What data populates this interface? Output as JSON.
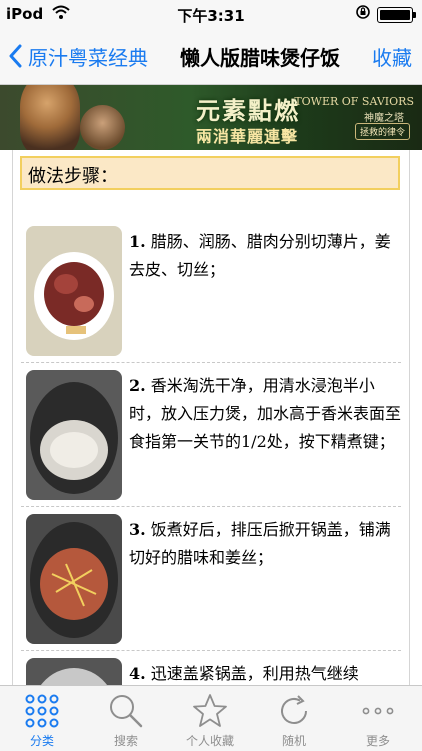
{
  "status": {
    "carrier": "iPod",
    "time": "下午3:31"
  },
  "nav": {
    "back_label": "原汁粤菜经典",
    "title": "懒人版腊味煲仔饭",
    "favorite_label": "收藏"
  },
  "banner": {
    "slogan_main": "元素點燃",
    "slogan_sub": "兩消華麗連擊",
    "brand_en": "TOWER OF SAVIORS",
    "brand_cn": "神魔之塔",
    "brand_tag": "拯救的律令"
  },
  "section_title": "做法步骤：",
  "steps": [
    {
      "num": "1.",
      "text": "腊肠、润肠、腊肉分别切薄片，姜去皮、切丝；"
    },
    {
      "num": "2.",
      "text": "香米淘洗干净，用清水浸泡半小时，放入压力煲，加水高于香米表面至食指第一关节的1/2处，按下精煮键；"
    },
    {
      "num": "3.",
      "text": "饭煮好后，排压后掀开锅盖，铺满切好的腊味和姜丝；"
    },
    {
      "num": "4.",
      "text": "迅速盖紧锅盖，利用热气继续"
    }
  ],
  "tabs": [
    {
      "label": "分类",
      "icon": "grid-icon",
      "active": true
    },
    {
      "label": "搜索",
      "icon": "search-icon"
    },
    {
      "label": "个人收藏",
      "icon": "star-icon"
    },
    {
      "label": "随机",
      "icon": "refresh-icon"
    },
    {
      "label": "更多",
      "icon": "more-icon"
    }
  ],
  "colors": {
    "accent": "#1a7bf0",
    "header_bg": "#fbe8c6",
    "header_border": "#f2cf5e"
  }
}
